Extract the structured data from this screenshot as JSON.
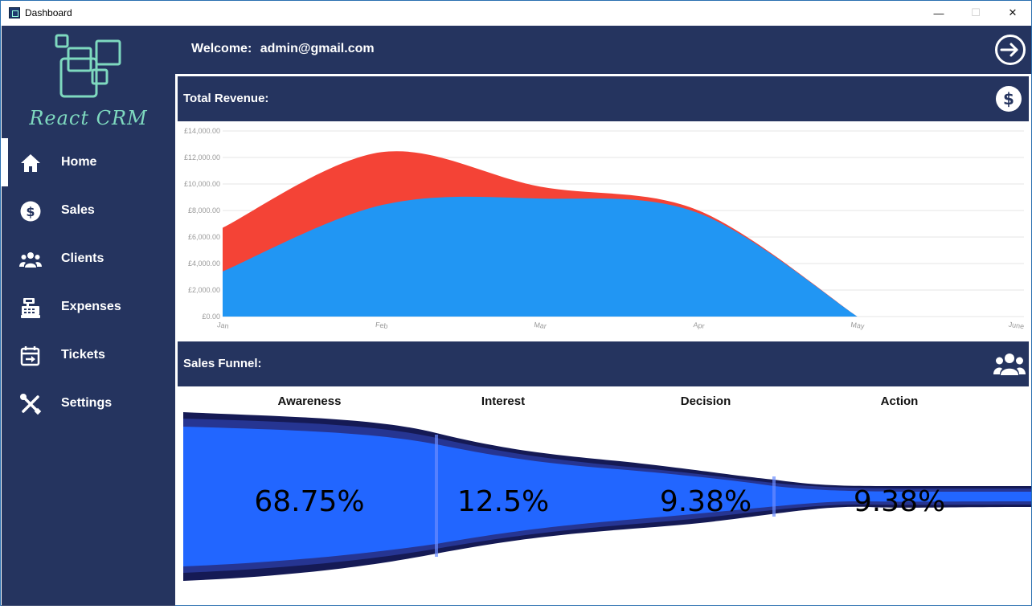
{
  "window": {
    "title": "Dashboard",
    "controls": {
      "minimize": "—",
      "maximize": "☐",
      "close": "✕"
    }
  },
  "sidebar": {
    "logo_text": "React CRM",
    "items": [
      {
        "label": "Home",
        "icon": "home-icon",
        "active": true
      },
      {
        "label": "Sales",
        "icon": "dollar-circle-icon",
        "active": false
      },
      {
        "label": "Clients",
        "icon": "users-icon",
        "active": false
      },
      {
        "label": "Expenses",
        "icon": "cash-register-icon",
        "active": false
      },
      {
        "label": "Tickets",
        "icon": "calendar-arrow-icon",
        "active": false
      },
      {
        "label": "Settings",
        "icon": "tools-icon",
        "active": false
      }
    ]
  },
  "header": {
    "welcome_label": "Welcome:",
    "user_email": "admin@gmail.com",
    "logout_icon": "logout-icon"
  },
  "revenue_panel": {
    "title": "Total Revenue:",
    "icon": "dollar-circle-icon"
  },
  "funnel_panel": {
    "title": "Sales Funnel:",
    "icon": "users-icon",
    "stages": [
      {
        "label": "Awareness",
        "percent": "68.75%"
      },
      {
        "label": "Interest",
        "percent": "12.5%"
      },
      {
        "label": "Decision",
        "percent": "9.38%"
      },
      {
        "label": "Action",
        "percent": "9.38%"
      }
    ]
  },
  "colors": {
    "sidebar_bg": "#25345f",
    "accent_logo": "#7ed9bf",
    "series_blue": "#2196f3",
    "series_red": "#f44336",
    "funnel_fill": "#2266ff",
    "funnel_dark": "#151a55"
  },
  "chart_data": {
    "type": "area",
    "stacked": true,
    "categories": [
      "Jan",
      "Feb",
      "Mar",
      "Apr",
      "May",
      "June"
    ],
    "ylim": [
      0,
      14000
    ],
    "yticks": [
      "£0.00",
      "£2,000.00",
      "£4,000.00",
      "£6,000.00",
      "£8,000.00",
      "£10,000.00",
      "£12,000.00",
      "£14,000.00"
    ],
    "grid": true,
    "series": [
      {
        "values": [
          3400,
          8400,
          8900,
          7800,
          0
        ],
        "color": "#2196f3"
      },
      {
        "values": [
          3300,
          4000,
          900,
          200,
          0
        ],
        "color": "#f44336"
      }
    ]
  }
}
